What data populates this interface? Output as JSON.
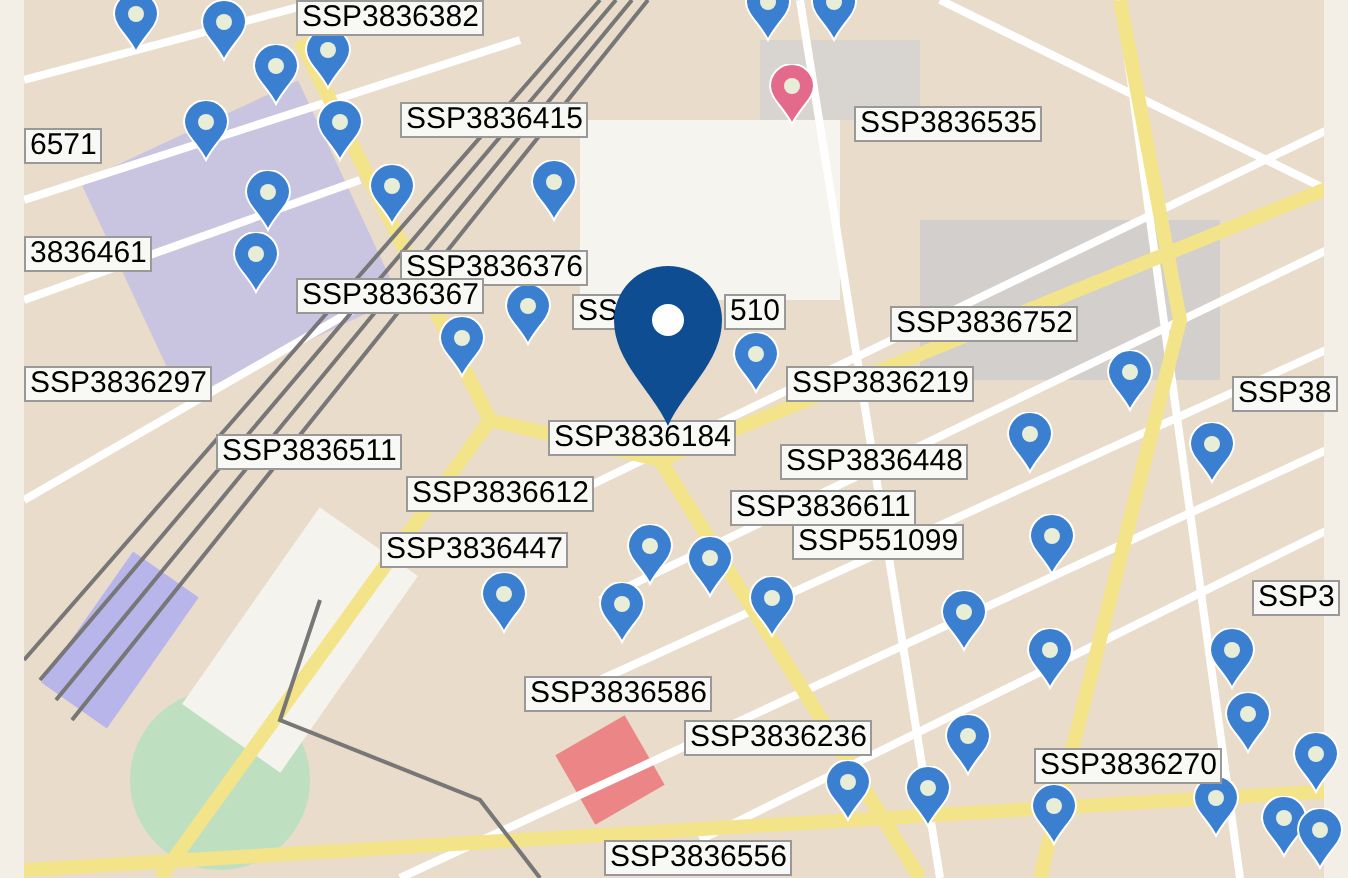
{
  "map": {
    "labels": [
      {
        "text": "SSP3836382"
      },
      {
        "text": "6571"
      },
      {
        "text": "SSP3836415"
      },
      {
        "text": "SSP3836535"
      },
      {
        "text": "3836461"
      },
      {
        "text": "SSP3836376"
      },
      {
        "text": "SSP3836367"
      },
      {
        "text": "SS"
      },
      {
        "text": "510"
      },
      {
        "text": "SSP3836752"
      },
      {
        "text": "SSP3836297"
      },
      {
        "text": "SSP3836219"
      },
      {
        "text": "SSP38"
      },
      {
        "text": "SSP3836184"
      },
      {
        "text": "SSP3836511"
      },
      {
        "text": "SSP3836448"
      },
      {
        "text": "SSP3836612"
      },
      {
        "text": "SSP3836611"
      },
      {
        "text": "SSP3836447"
      },
      {
        "text": "SSP551099"
      },
      {
        "text": "SSP3"
      },
      {
        "text": "SSP3836586"
      },
      {
        "text": "SSP3836236"
      },
      {
        "text": "SSP3836270"
      },
      {
        "text": "SSP3836556"
      }
    ],
    "markers": [
      {
        "color": "#3a7fd0"
      },
      {
        "color": "#3a7fd0"
      },
      {
        "color": "#3a7fd0"
      },
      {
        "color": "#3a7fd0"
      },
      {
        "color": "#3a7fd0"
      },
      {
        "color": "#3a7fd0"
      },
      {
        "color": "#3a7fd0"
      },
      {
        "color": "#3a7fd0"
      },
      {
        "color": "#3a7fd0"
      },
      {
        "color": "#3a7fd0"
      },
      {
        "color": "#3a7fd0"
      },
      {
        "color": "#3a7fd0"
      },
      {
        "color": "#3a7fd0"
      },
      {
        "color": "#3a7fd0"
      },
      {
        "color": "#3a7fd0"
      },
      {
        "color": "#e46a8c"
      },
      {
        "color": "#3a7fd0"
      },
      {
        "color": "#3a7fd0"
      },
      {
        "color": "#3a7fd0"
      },
      {
        "color": "#3a7fd0"
      },
      {
        "color": "#3a7fd0"
      },
      {
        "color": "#3a7fd0"
      },
      {
        "color": "#3a7fd0"
      },
      {
        "color": "#3a7fd0"
      },
      {
        "color": "#3a7fd0"
      },
      {
        "color": "#3a7fd0"
      },
      {
        "color": "#3a7fd0"
      },
      {
        "color": "#3a7fd0"
      },
      {
        "color": "#3a7fd0"
      },
      {
        "color": "#3a7fd0"
      },
      {
        "color": "#3a7fd0"
      },
      {
        "color": "#3a7fd0"
      },
      {
        "color": "#3a7fd0"
      },
      {
        "color": "#3a7fd0"
      },
      {
        "color": "#3a7fd0"
      },
      {
        "color": "#3a7fd0"
      },
      {
        "color": "#3a7fd0"
      }
    ],
    "selected_marker": {
      "color": "#0e4d92"
    }
  }
}
